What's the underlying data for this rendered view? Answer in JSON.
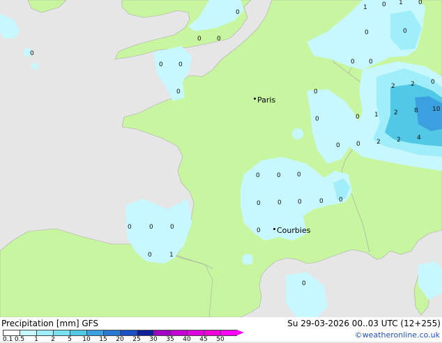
{
  "footer": {
    "title": "Precipitation [mm] GFS",
    "date": "Su 29-03-2026 00..03 UTC (12+255)",
    "credit": "©weatheronline.co.uk"
  },
  "cities": [
    {
      "name": "Paris"
    },
    {
      "name": "Courbies"
    }
  ],
  "value_labels": [
    "0",
    "0",
    "0",
    "0",
    "1",
    "1",
    "0",
    "0",
    "0",
    "0",
    "0",
    "0",
    "0",
    "0",
    "0",
    "2",
    "2",
    "0",
    "1",
    "2",
    "8",
    "10",
    "2",
    "2",
    "4",
    "0",
    "0",
    "0",
    "0",
    "0",
    "0",
    "0",
    "0",
    "0",
    "0",
    "0",
    "0",
    "0",
    "0",
    "0",
    "0",
    "1",
    "0",
    "0",
    "0"
  ],
  "legend": {
    "ticks": [
      "0.1",
      "0.5",
      "1",
      "2",
      "5",
      "10",
      "15",
      "20",
      "25",
      "30",
      "35",
      "40",
      "45",
      "50"
    ],
    "colors": [
      "#ffffff",
      "#c8f8ff",
      "#a0eefa",
      "#78e0f0",
      "#50c8e6",
      "#3aa0e0",
      "#2878d8",
      "#1a50c8",
      "#10209a",
      "#a000c8",
      "#c800d8",
      "#e000e0",
      "#f000d8",
      "#ff00ff"
    ]
  },
  "colors": {
    "land": "#c8f5a0",
    "sea": "#e6e6e6",
    "precip_light": "#c8f8ff",
    "precip_mid": "#a0eefa",
    "precip_heavy": "#50c8e6",
    "precip_very_heavy": "#3aa0e0"
  }
}
